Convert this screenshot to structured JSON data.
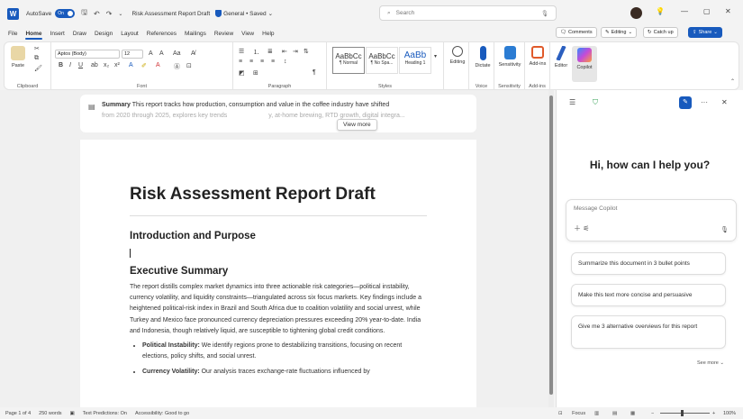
{
  "titlebar": {
    "autosave_label": "AutoSave",
    "autosave_state": "On",
    "doc_title": "Risk Assessment Report Draft",
    "sensitivity": "General • Saved",
    "search_placeholder": "Search"
  },
  "menu": {
    "tabs": [
      "File",
      "Home",
      "Insert",
      "Draw",
      "Design",
      "Layout",
      "References",
      "Mailings",
      "Review",
      "View",
      "Help"
    ],
    "active_tab": "Home",
    "comments": "Comments",
    "editing": "Editing",
    "catchup": "Catch up",
    "share": "Share"
  },
  "ribbon": {
    "clipboard_label": "Clipboard",
    "paste_label": "Paste",
    "font_name": "Aptos (Body)",
    "font_size": "12",
    "font_label": "Font",
    "paragraph_label": "Paragraph",
    "styles": [
      {
        "preview": "AaBbCc",
        "name": "¶ Normal"
      },
      {
        "preview": "AaBbCc",
        "name": "¶ No Spa..."
      },
      {
        "preview": "AaBb",
        "name": "Heading 1"
      }
    ],
    "styles_label": "Styles",
    "editing_label": "Editing",
    "dictate_label": "Dictate",
    "sensitivity_label": "Sensitivity",
    "addins_label": "Add-ins",
    "editor_label": "Editor",
    "copilot_label": "Copilot",
    "voice_group": "Voice",
    "sensitivity_group": "Sensitivity",
    "addins_group": "Add-ins"
  },
  "summary": {
    "label": "Summary",
    "text": "This report tracks how production, consumption and value in the coffee industry have shifted",
    "faded": "from 2020 through 2025, explores key trends",
    "faded_tail": "y, at-home brewing, RTD growth, digital integra...",
    "view_more": "View more"
  },
  "document": {
    "title": "Risk Assessment Report Draft",
    "h_intro": "Introduction and Purpose",
    "h_exec": "Executive Summary",
    "exec_p": "The report distills complex market dynamics into three actionable risk categories—political instability, currency volatility, and liquidity constraints—triangulated across six focus markets. Key findings include a heightened political-risk index in Brazil and South Africa due to coalition volatility and social unrest, while Turkey and Mexico face pronounced currency depreciation pressures exceeding 20% year-to-date. India and Indonesia, though relatively liquid, are susceptible to tightening global credit conditions.",
    "bullet1_bold": "Political Instability:",
    "bullet1_text": " We identify regions prone to destabilizing transitions, focusing on recent elections, policy shifts, and social unrest.",
    "bullet2_bold": "Currency Volatility:",
    "bullet2_text": " Our analysis traces exchange-rate fluctuations influenced by"
  },
  "copilot": {
    "greeting": "Hi, how can I help you?",
    "placeholder": "Message Copilot",
    "suggestions": [
      "Summarize this document in 3 bullet points",
      "Make this text more concise and persuasive",
      "Give me 3 alternative overviews for this report"
    ],
    "see_more": "See more"
  },
  "status": {
    "page": "Page 1 of 4",
    "words": "250 words",
    "predictions": "Text Predictions: On",
    "accessibility": "Accessibility: Good to go",
    "focus": "Focus",
    "zoom": "100%"
  },
  "colors": {
    "accent": "#185abd"
  }
}
